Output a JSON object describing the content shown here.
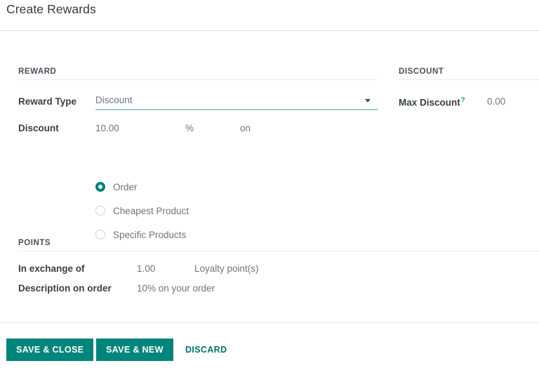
{
  "dialog": {
    "title": "Create Rewards"
  },
  "sections": {
    "reward": "REWARD",
    "discount": "DISCOUNT",
    "points": "POINTS"
  },
  "reward": {
    "reward_type": {
      "label": "Reward Type",
      "value": "Discount",
      "caret": "chevron-down-icon"
    },
    "discount": {
      "label": "Discount",
      "value": "10.00",
      "unit": "%",
      "preposition": "on"
    },
    "applies_to": {
      "options": [
        {
          "label": "Order",
          "selected": true
        },
        {
          "label": "Cheapest Product",
          "selected": false
        },
        {
          "label": "Specific Products",
          "selected": false
        }
      ]
    }
  },
  "discount_panel": {
    "max_discount": {
      "label": "Max Discount",
      "help": "?",
      "value": "0.00"
    }
  },
  "points": {
    "exchange": {
      "label": "In exchange of",
      "value": "1.00",
      "unit": "Loyalty point(s)"
    },
    "description": {
      "label": "Description on order",
      "value": "10% on your order"
    }
  },
  "footer": {
    "save_close": "SAVE & CLOSE",
    "save_new": "SAVE & NEW",
    "discard": "DISCARD"
  },
  "colors": {
    "accent": "#00857c",
    "accent_dark": "#00716b",
    "underline": "#9ccac9",
    "label": "#383f45",
    "value": "#6c757d",
    "divider": "#dee2e6"
  }
}
